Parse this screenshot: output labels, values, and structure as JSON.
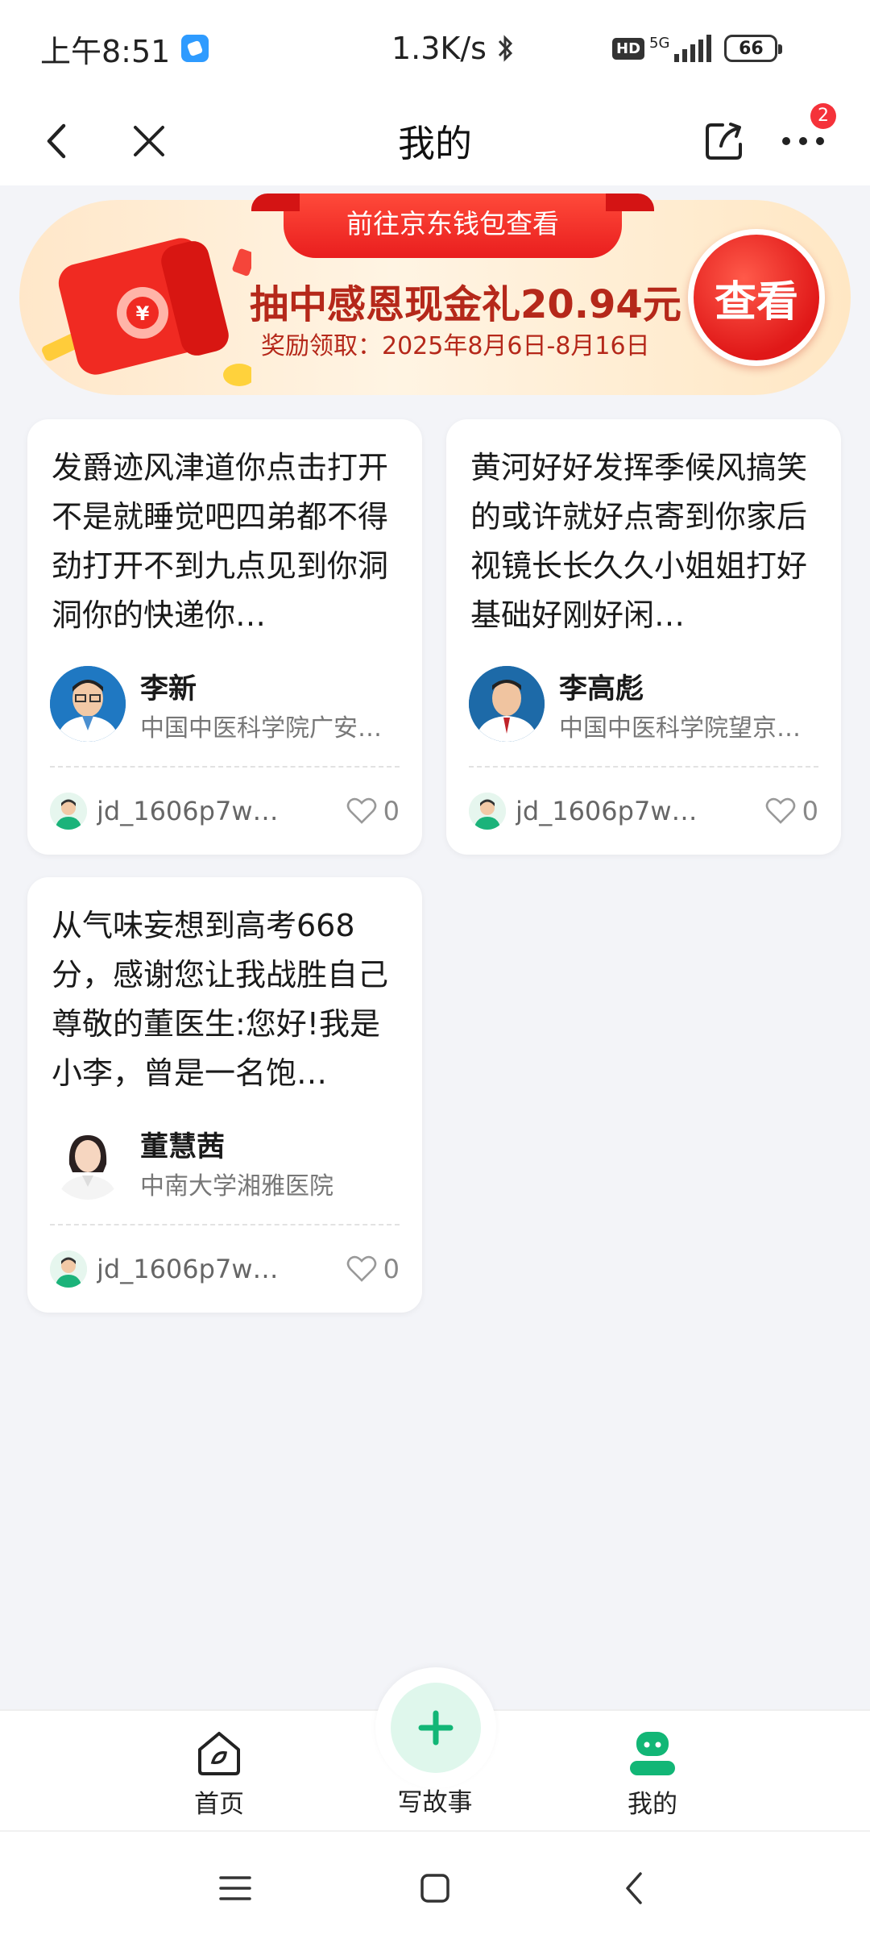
{
  "status_bar": {
    "time": "上午8:51",
    "net_speed": "1.3K/s",
    "hd": "HD",
    "network": "5G",
    "battery": "66"
  },
  "nav": {
    "title": "我的",
    "more_badge": "2"
  },
  "banner": {
    "tab_text": "前往京东钱包查看",
    "headline": "抽中感恩现金礼20.94元",
    "date_text": "奖励领取：2025年8月6日-8月16日",
    "button_label": "查看"
  },
  "cards": [
    {
      "text": "发爵迹风津道你点击打开不是就睡觉吧四弟都不得劲打开不到九点见到你洞洞你的快递你…",
      "doctor_name": "李新",
      "hospital": "中国中医科学院广安…",
      "user": "jd_1606p7w1…",
      "likes": "0"
    },
    {
      "text": "黄河好好发挥季候风搞笑的或许就好点寄到你家后视镜长长久久小姐姐打好基础好刚好闲…",
      "doctor_name": "李高彪",
      "hospital": "中国中医科学院望京…",
      "user": "jd_1606p7w1…",
      "likes": "0"
    },
    {
      "text": "从气味妄想到高考668分，感谢您让我战胜自己尊敬的董医生:您好!我是小李，曾是一名饱…",
      "doctor_name": "董慧茜",
      "hospital": "中南大学湘雅医院",
      "user": "jd_1606p7w1…",
      "likes": "0"
    }
  ],
  "tab_bar": {
    "home": "首页",
    "write": "写故事",
    "mine": "我的"
  },
  "colors": {
    "accent_green": "#12b676",
    "banner_red": "#e91e1e",
    "badge_red": "#f5323a"
  }
}
